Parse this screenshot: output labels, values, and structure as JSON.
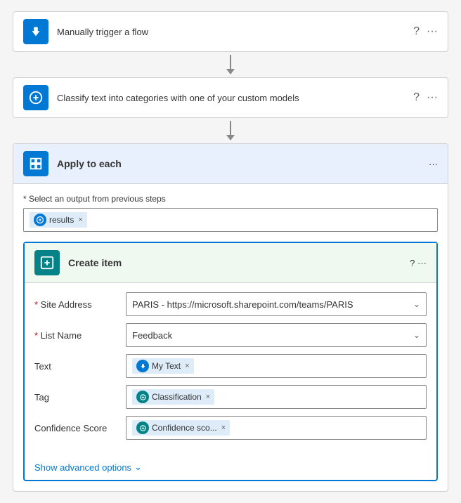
{
  "steps": [
    {
      "id": "trigger",
      "title": "Manually trigger a flow",
      "iconType": "hand",
      "iconBg": "#0078d4"
    },
    {
      "id": "classify",
      "title": "Classify text into categories with one of your custom models",
      "iconType": "classify",
      "iconBg": "#0078d4"
    }
  ],
  "applyEach": {
    "title": "Apply to each",
    "selectOutputLabel": "* Select an output from previous steps",
    "token": {
      "label": "results",
      "iconType": "circle"
    }
  },
  "createItem": {
    "title": "Create item",
    "fields": [
      {
        "label": "* Site Address",
        "type": "dropdown",
        "value": "PARIS - https://microsoft.sharepoint.com/teams/PARIS"
      },
      {
        "label": "* List Name",
        "type": "dropdown",
        "value": "Feedback"
      },
      {
        "label": "Text",
        "type": "token",
        "tokens": [
          {
            "label": "My Text",
            "iconType": "hand"
          }
        ]
      },
      {
        "label": "Tag",
        "type": "token",
        "tokens": [
          {
            "label": "Classification",
            "iconType": "classify"
          }
        ]
      },
      {
        "label": "Confidence Score",
        "type": "token",
        "tokens": [
          {
            "label": "Confidence sco...",
            "iconType": "classify"
          }
        ]
      }
    ],
    "showAdvanced": "Show advanced options"
  },
  "icons": {
    "question": "?",
    "more": "···",
    "close": "×",
    "chevronDown": "∨"
  }
}
